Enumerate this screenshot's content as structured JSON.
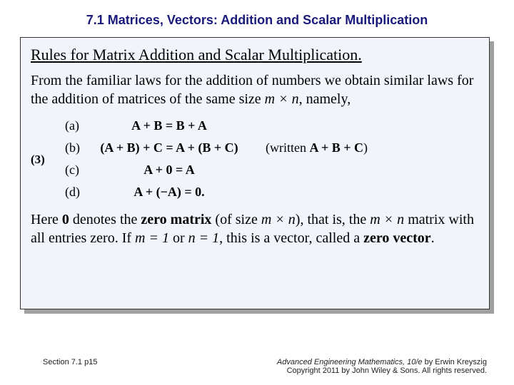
{
  "slide": {
    "title": "7.1 Matrices, Vectors:  Addition and Scalar Multiplication"
  },
  "box": {
    "heading": "Rules for Matrix Addition and Scalar Multiplication.",
    "intro_prefix": "From the familiar laws for the addition of numbers we obtain similar laws for the addition of matrices of the same size ",
    "intro_dims": "m × n",
    "intro_suffix": ", namely,",
    "eq_number": "(3)",
    "laws": {
      "a_label": "(a)",
      "a_eq": "A + B = B + A",
      "b_label": "(b)",
      "b_eq": "(A + B) + C = A + (B + C)",
      "b_note_prefix": "(written ",
      "b_note_eq": "A + B + C",
      "b_note_suffix": ")",
      "c_label": "(c)",
      "c_eq": "A + 0 = A",
      "d_label": "(d)",
      "d_eq": "A + (−A) = 0."
    },
    "closing": {
      "p1": "Here ",
      "zero_bold": "0",
      "p2": " denotes the ",
      "zm": "zero matrix",
      "p3": " (of size ",
      "dims": "m × n",
      "p4": "), that is, the ",
      "dims2": "m × n",
      "p5": " matrix with all entries zero. If ",
      "m1": "m = 1",
      "p6": " or ",
      "n1": "n = 1",
      "p7": ", this is a vector, called a ",
      "zv": "zero vector",
      "p8": "."
    }
  },
  "footer": {
    "left": "Section 7.1  p15",
    "book": "Advanced Engineering Mathematics, 10/e",
    "author": " by Erwin Kreyszig",
    "copyright": "Copyright 2011 by John Wiley & Sons. All rights reserved."
  }
}
